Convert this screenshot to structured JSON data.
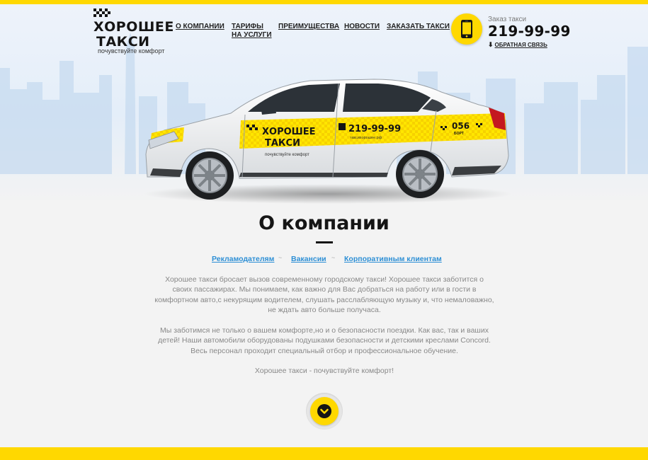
{
  "brand": {
    "name_line1": "ХОРОШЕЕ",
    "name_line2": "ТАКСИ",
    "slogan": "почувствуйте комфорт",
    "color_accent": "#ffd800"
  },
  "nav": {
    "items": [
      {
        "label": "О КОМПАНИИ"
      },
      {
        "label": "ТАРИФЫ НА УСЛУГИ"
      },
      {
        "label": "ПРЕИМУЩЕСТВА"
      },
      {
        "label": "НОВОСТИ"
      },
      {
        "label": "ЗАКАЗАТЬ ТАКСИ"
      }
    ]
  },
  "contact": {
    "icon": "smartphone-icon",
    "order_label": "Заказ такси",
    "phone": "219-99-99",
    "feedback_label": "ОБРАТНАЯ СВЯЗЬ",
    "feedback_icon": "arrow-down-icon"
  },
  "car": {
    "brand_line1": "ХОРОШЕЕ",
    "brand_line2": "ТАКСИ",
    "slogan": "почувствуйте комфорт",
    "phone": "219-99-99",
    "site": "таксихорошее.рф",
    "board_number": "056",
    "board_label": "БОРТ"
  },
  "section": {
    "title": "О компании",
    "links": [
      {
        "label": "Рекламодателям"
      },
      {
        "label": "Вакансии"
      },
      {
        "label": "Корпоративным клиентам"
      }
    ],
    "separator": "~",
    "paragraphs": [
      "Хорошее такси бросает вызов современному городскому такси! Хорошее такси заботится о своих пассажирах. Мы понимаем, как важно для Вас добраться на работу или в гости в комфортном авто,с некурящим водителем, слушать расслабляющую музыку и, что немаловажно, не ждать авто больше получаса.",
      "Мы заботимся не только о вашем комфорте,но и о безопасности поездки. Как вас, так и ваших детей! Наши автомобили оборудованы подушками безопасности и детскими креслами Concord. Весь персонал проходит специальный отбор и профессиональное обучение.",
      "Хорошее такси - почувствуйте комфорт!"
    ],
    "scroll_icon": "chevron-down-icon"
  }
}
